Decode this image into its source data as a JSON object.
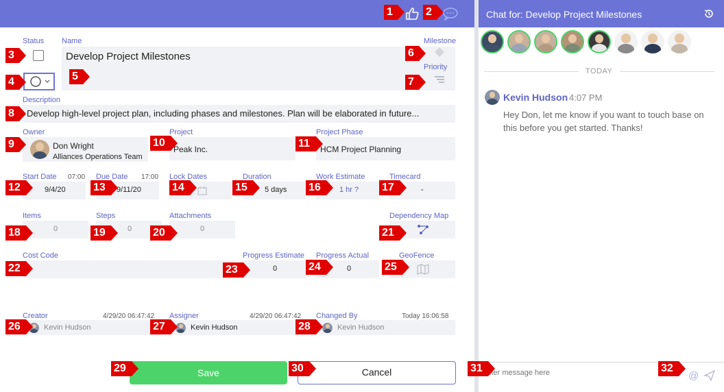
{
  "header": {
    "like_icon": "thumbs-up-icon",
    "chat_icon": "chat-bubble-icon"
  },
  "task": {
    "status_label": "Status",
    "name_label": "Name",
    "name_value": "Develop Project Milestones",
    "milestone_label": "Milestone",
    "priority_label": "Priority",
    "description_label": "Description",
    "description_value": "Develop high-level project plan, including phases and milestones.  Plan will be elaborated in future...",
    "owner_label": "Owner",
    "owner_name": "Don Wright",
    "owner_team": "Alliances Operations Team",
    "project_label": "Project",
    "project_value": "Peak Inc.",
    "phase_label": "Project Phase",
    "phase_value": "HCM Project Planning",
    "start_label": "Start Date",
    "start_time": "07:00",
    "start_value": "9/4/20",
    "due_label": "Due Date",
    "due_time": "17:00",
    "due_value": "9/11/20",
    "lock_label": "Lock Dates",
    "duration_label": "Duration",
    "duration_value": "5 days",
    "work_label": "Work Estimate",
    "work_value": "1 hr ?",
    "timecard_label": "Timecard",
    "timecard_value": "-",
    "items_label": "Items",
    "items_value": "0",
    "steps_label": "Steps",
    "steps_value": "0",
    "attach_label": "Attachments",
    "attach_value": "0",
    "depmap_label": "Dependency Map",
    "cost_label": "Cost Code",
    "prog_est_label": "Progress Estimate",
    "prog_est_value": "0",
    "prog_act_label": "Progress Actual",
    "prog_act_value": "0",
    "geo_label": "GeoFence",
    "creator_label": "Creator",
    "creator_time": "4/29/20 06:47:42",
    "creator_name": "Kevin Hudson",
    "assigner_label": "Assigner",
    "assigner_time": "4/29/20 06:47:42",
    "assigner_name": "Kevin Hudson",
    "changed_label": "Changed By",
    "changed_time": "Today 16:06:58",
    "changed_name": "Kevin Hudson"
  },
  "buttons": {
    "save": "Save",
    "cancel": "Cancel"
  },
  "chat": {
    "title": "Chat for: Develop Project Milestones",
    "today": "TODAY",
    "author": "Kevin Hudson",
    "time": "4:07 PM",
    "message": "Hey Don, let me know if you want to touch base on this before you get started. Thanks!",
    "placeholder": "Enter message here",
    "at_symbol": "@"
  },
  "markers": [
    "1",
    "2",
    "3",
    "4",
    "5",
    "6",
    "7",
    "8",
    "9",
    "10",
    "11",
    "12",
    "13",
    "14",
    "15",
    "16",
    "17",
    "18",
    "19",
    "20",
    "21",
    "22",
    "23",
    "24",
    "25",
    "26",
    "27",
    "28",
    "29",
    "30",
    "31",
    "32"
  ],
  "colors": {
    "accent": "#6b73d6",
    "label": "#5d64c6",
    "save": "#4cd46a",
    "marker": "#e00000"
  }
}
